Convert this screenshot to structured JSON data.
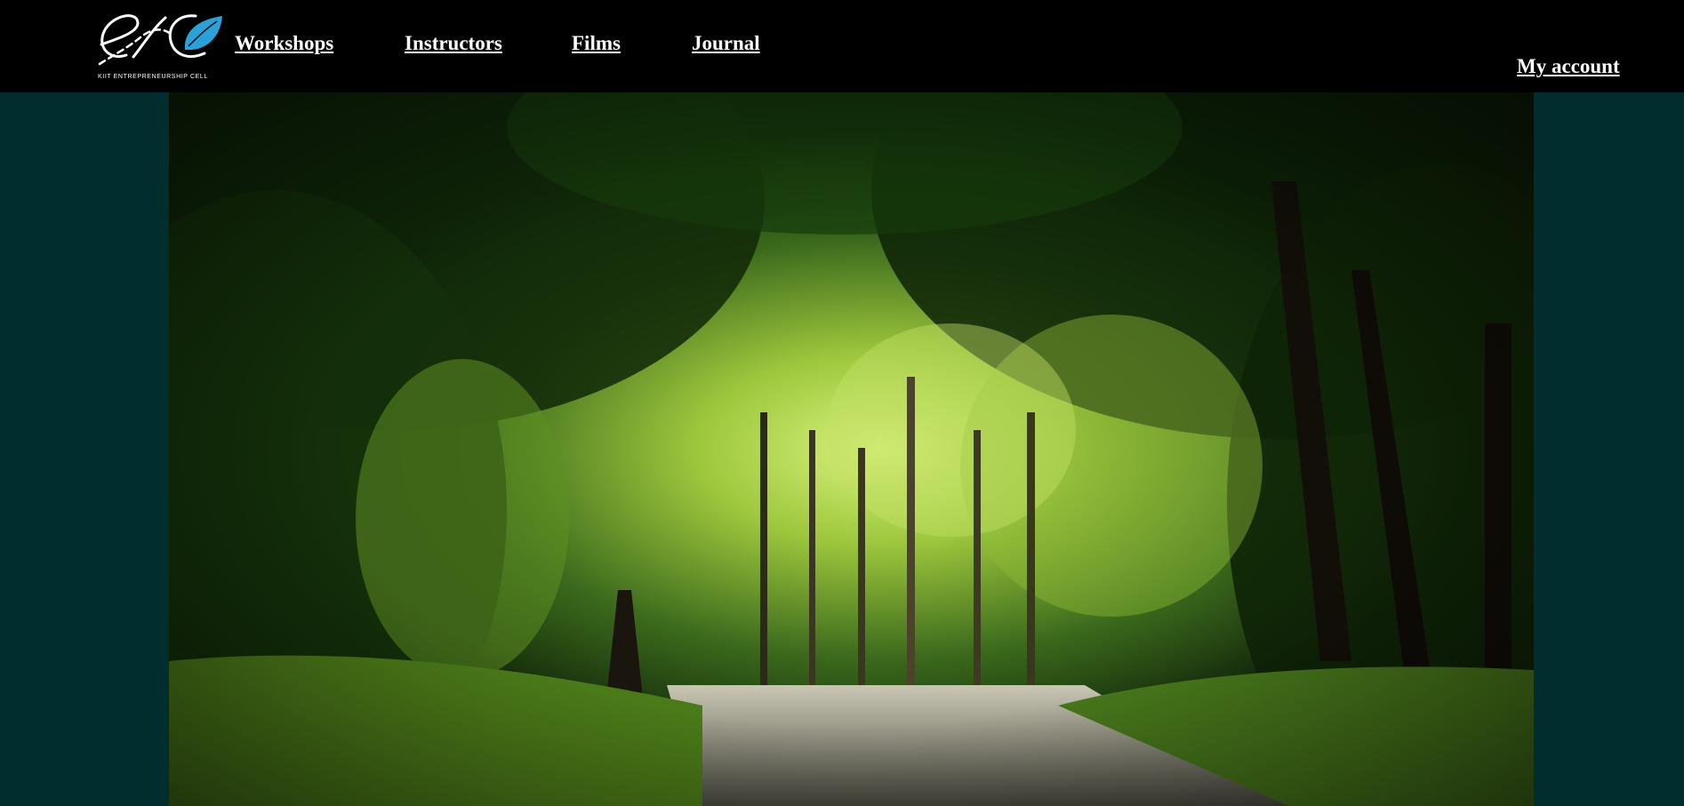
{
  "header": {
    "logo": {
      "alt": "eXc",
      "tagline": "KIIT ENTREPRENEURSHIP CELL",
      "accent_color": "#2aa1d9"
    },
    "nav": [
      {
        "label": "Workshops"
      },
      {
        "label": "Instructors"
      },
      {
        "label": "Films"
      },
      {
        "label": "Journal"
      }
    ],
    "account_label": "My account"
  },
  "hero": {
    "image": "forest-path-photo"
  },
  "colors": {
    "header_bg": "#000000",
    "page_bg": "#002d2e",
    "link": "#ffffff"
  }
}
